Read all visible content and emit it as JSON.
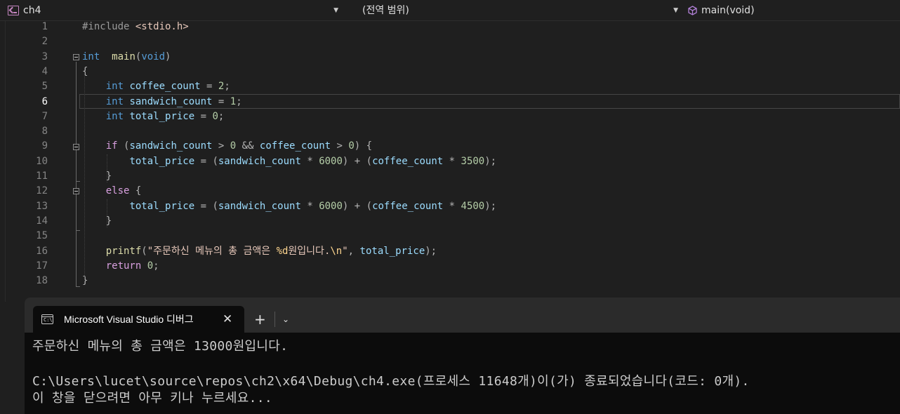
{
  "navbar": {
    "project": "ch4",
    "scope": "(전역 범위)",
    "member": "main(void)"
  },
  "editor": {
    "active_line": 6,
    "line_numbers": [
      "1",
      "2",
      "3",
      "4",
      "5",
      "6",
      "7",
      "8",
      "9",
      "10",
      "11",
      "12",
      "13",
      "14",
      "15",
      "16",
      "17",
      "18"
    ],
    "lines": [
      [
        [
          "pp",
          "#include "
        ],
        [
          "inc",
          "<stdio.h>"
        ]
      ],
      [],
      [
        [
          "kw",
          "int"
        ],
        [
          "",
          "  "
        ],
        [
          "fn",
          "main"
        ],
        [
          "op",
          "("
        ],
        [
          "kw",
          "void"
        ],
        [
          "op",
          ")"
        ]
      ],
      [
        [
          "op",
          "{"
        ]
      ],
      [
        [
          "",
          "    "
        ],
        [
          "kw",
          "int"
        ],
        [
          "",
          ""
        ],
        [
          "var",
          " coffee_count"
        ],
        [
          "op",
          " = "
        ],
        [
          "num",
          "2"
        ],
        [
          "op",
          ";"
        ]
      ],
      [
        [
          "",
          "    "
        ],
        [
          "kw",
          "int"
        ],
        [
          "var",
          " sandwich_count"
        ],
        [
          "op",
          " = "
        ],
        [
          "num",
          "1"
        ],
        [
          "op",
          ";"
        ]
      ],
      [
        [
          "",
          "    "
        ],
        [
          "kw",
          "int"
        ],
        [
          "var",
          " total_price"
        ],
        [
          "op",
          " = "
        ],
        [
          "num",
          "0"
        ],
        [
          "op",
          ";"
        ]
      ],
      [],
      [
        [
          "",
          "    "
        ],
        [
          "ctl",
          "if"
        ],
        [
          "op",
          " ("
        ],
        [
          "var",
          "sandwich_count"
        ],
        [
          "op",
          " > "
        ],
        [
          "num",
          "0"
        ],
        [
          "op",
          " && "
        ],
        [
          "var",
          "coffee_count"
        ],
        [
          "op",
          " > "
        ],
        [
          "num",
          "0"
        ],
        [
          "op",
          ") {"
        ]
      ],
      [
        [
          "",
          "        "
        ],
        [
          "var",
          "total_price"
        ],
        [
          "op",
          " = ("
        ],
        [
          "var",
          "sandwich_count"
        ],
        [
          "op",
          " * "
        ],
        [
          "num",
          "6000"
        ],
        [
          "op",
          ") + ("
        ],
        [
          "var",
          "coffee_count"
        ],
        [
          "op",
          " * "
        ],
        [
          "num",
          "3500"
        ],
        [
          "op",
          ");"
        ]
      ],
      [
        [
          "",
          "    "
        ],
        [
          "op",
          "}"
        ]
      ],
      [
        [
          "",
          "    "
        ],
        [
          "ctl",
          "else"
        ],
        [
          "op",
          " {"
        ]
      ],
      [
        [
          "",
          "        "
        ],
        [
          "var",
          "total_price"
        ],
        [
          "op",
          " = ("
        ],
        [
          "var",
          "sandwich_count"
        ],
        [
          "op",
          " * "
        ],
        [
          "num",
          "6000"
        ],
        [
          "op",
          ") + ("
        ],
        [
          "var",
          "coffee_count"
        ],
        [
          "op",
          " * "
        ],
        [
          "num",
          "4500"
        ],
        [
          "op",
          ");"
        ]
      ],
      [
        [
          "",
          "    "
        ],
        [
          "op",
          "}"
        ]
      ],
      [],
      [
        [
          "",
          "    "
        ],
        [
          "fn",
          "printf"
        ],
        [
          "op",
          "("
        ],
        [
          "str",
          "\"주문하신 메뉴의 총 금액은 "
        ],
        [
          "esc",
          "%d"
        ],
        [
          "str",
          "원입니다."
        ],
        [
          "esc",
          "\\n"
        ],
        [
          "str",
          "\""
        ],
        [
          "op",
          ", "
        ],
        [
          "var",
          "total_price"
        ],
        [
          "op",
          ");"
        ]
      ],
      [
        [
          "",
          "    "
        ],
        [
          "ctl",
          "return"
        ],
        [
          "op",
          " "
        ],
        [
          "num",
          "0"
        ],
        [
          "op",
          ";"
        ]
      ],
      [
        [
          "op",
          "}"
        ]
      ]
    ]
  },
  "terminal": {
    "tab_icon_text": "C:\\",
    "tab_title": "Microsoft Visual Studio 디버그",
    "close_glyph": "✕",
    "add_glyph": "+",
    "menu_glyph": "⌄",
    "output": [
      "주문하신 메뉴의 총 금액은 13000원입니다.",
      "",
      "C:\\Users\\lucet\\source\\repos\\ch2\\x64\\Debug\\ch4.exe(프로세스 11648개)이(가) 종료되었습니다(코드: 0개).",
      "이 창을 닫으려면 아무 키나 누르세요..."
    ]
  }
}
